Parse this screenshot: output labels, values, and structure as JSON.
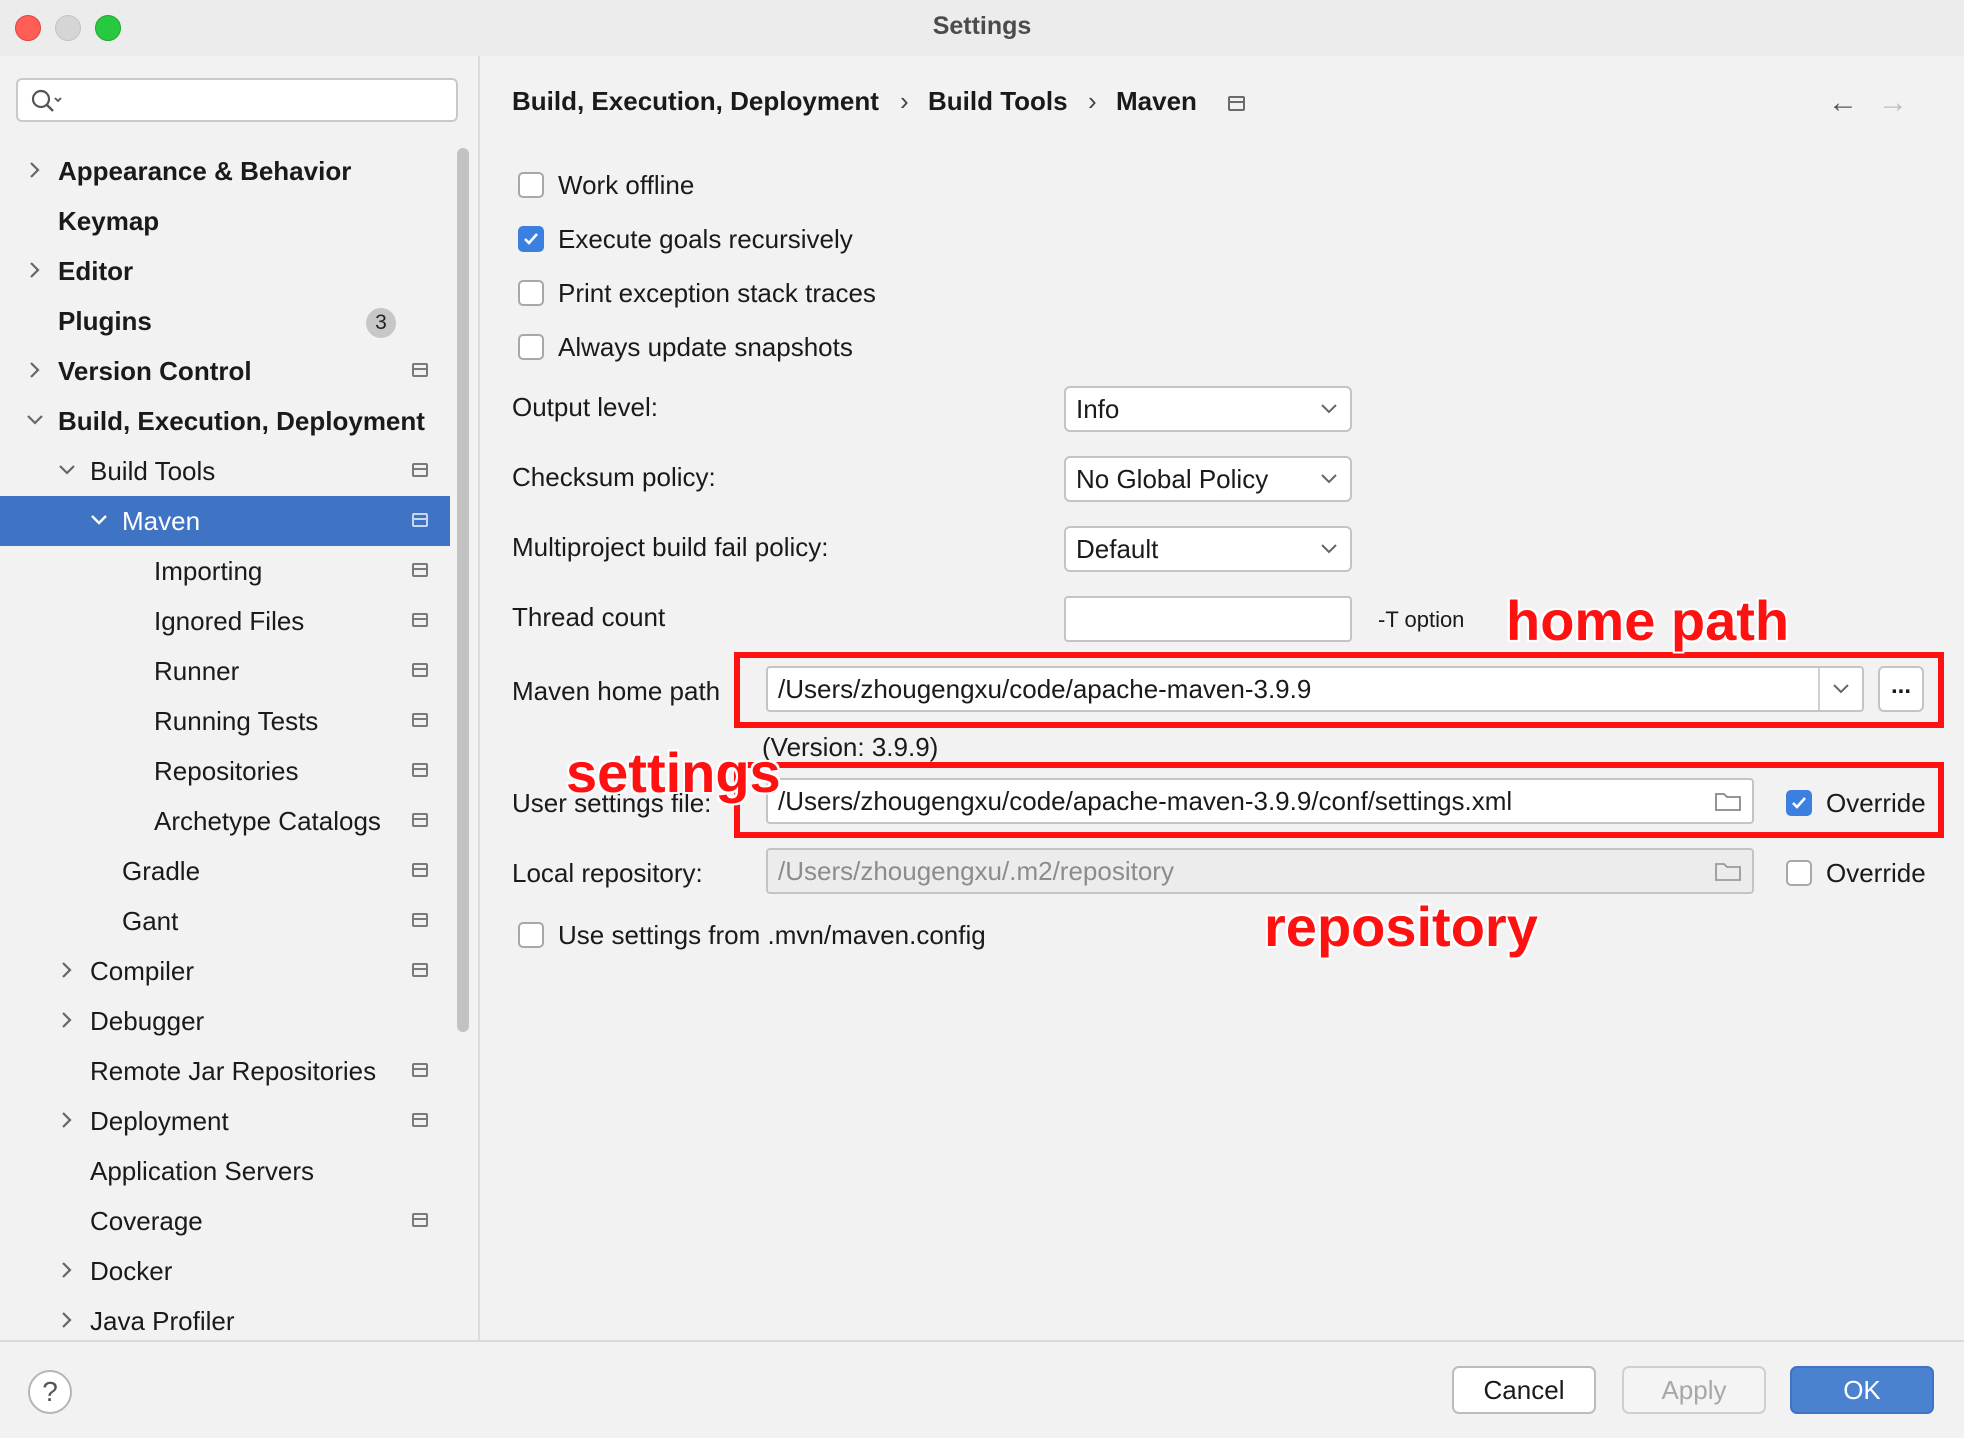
{
  "window": {
    "title": "Settings"
  },
  "sidebar": {
    "search_placeholder": "",
    "badge_plugins": "3",
    "items": [
      {
        "label": "Appearance & Behavior"
      },
      {
        "label": "Keymap"
      },
      {
        "label": "Editor"
      },
      {
        "label": "Plugins"
      },
      {
        "label": "Version Control"
      },
      {
        "label": "Build, Execution, Deployment"
      },
      {
        "label": "Build Tools"
      },
      {
        "label": "Maven"
      },
      {
        "label": "Importing"
      },
      {
        "label": "Ignored Files"
      },
      {
        "label": "Runner"
      },
      {
        "label": "Running Tests"
      },
      {
        "label": "Repositories"
      },
      {
        "label": "Archetype Catalogs"
      },
      {
        "label": "Gradle"
      },
      {
        "label": "Gant"
      },
      {
        "label": "Compiler"
      },
      {
        "label": "Debugger"
      },
      {
        "label": "Remote Jar Repositories"
      },
      {
        "label": "Deployment"
      },
      {
        "label": "Application Servers"
      },
      {
        "label": "Coverage"
      },
      {
        "label": "Docker"
      },
      {
        "label": "Java Profiler"
      }
    ]
  },
  "breadcrumb": {
    "c1": "Build, Execution, Deployment",
    "sep": "›",
    "c2": "Build Tools",
    "c3": "Maven"
  },
  "nav": {
    "back": "←",
    "forward": "→"
  },
  "options": {
    "work_offline": "Work offline",
    "execute_goals": "Execute goals recursively",
    "print_exception": "Print exception stack traces",
    "always_update": "Always update snapshots",
    "output_level_label": "Output level:",
    "output_level_value": "Info",
    "checksum_label": "Checksum policy:",
    "checksum_value": "No Global Policy",
    "multiproject_label": "Multiproject build fail policy:",
    "multiproject_value": "Default",
    "thread_count_label": "Thread count",
    "thread_count_value": "",
    "t_option": "-T option",
    "maven_home_label": "Maven home path",
    "maven_home_value": "/Users/zhougengxu/code/apache-maven-3.9.9",
    "browse": "...",
    "version": "(Version: 3.9.9)",
    "user_settings_label": "User settings file:",
    "user_settings_value": "/Users/zhougengxu/code/apache-maven-3.9.9/conf/settings.xml",
    "override1": "Override",
    "local_repo_label": "Local repository:",
    "local_repo_value": "/Users/zhougengxu/.m2/repository",
    "override2": "Override",
    "use_settings": "Use settings from .mvn/maven.config"
  },
  "annotations": {
    "home_path": "home path",
    "settings": "settings",
    "repository": "repository"
  },
  "buttons": {
    "help": "?",
    "cancel": "Cancel",
    "apply": "Apply",
    "ok": "OK"
  },
  "colors": {
    "accent": "#3f73c4",
    "annotation": "#ff1111",
    "checkbox_on": "#3b7fe0"
  }
}
